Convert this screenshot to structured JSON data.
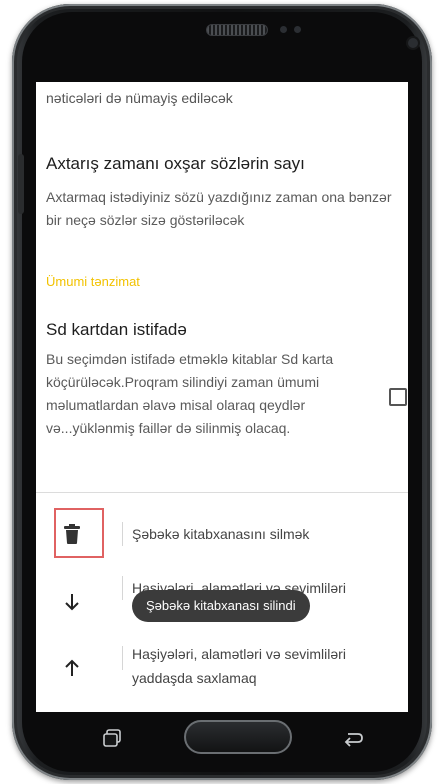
{
  "settings": {
    "prev_desc_tail": "nəticələri də nümayiş ediləcək",
    "similar_words": {
      "title": "Axtarış zamanı oxşar sözlərin sayı",
      "desc": "Axtarmaq istədiyiniz sözü yazdığınız zaman ona bənzər bir neçə sözlər sizə göstəriləcək"
    },
    "section_general": "Ümumi tənzimat",
    "sd_card": {
      "title": "Sd kartdan istifadə",
      "desc": "Bu seçimdən istifadə etməklə kitablar Sd karta köçürüləcək.Proqram silindiyi zaman ümumi məlumatlardan əlavə misal olaraq qeydlər və...yüklənmiş faillər də silinmiş olacaq.",
      "checked": false
    }
  },
  "actions": [
    {
      "icon": "trash-icon",
      "label": "Şəbəkə kitabxanasını silmək"
    },
    {
      "icon": "arrow-down-icon",
      "label": "Haşiyələri, alamətləri və sevimliləri"
    },
    {
      "icon": "arrow-up-icon",
      "label": "Haşiyələri, alamətləri və sevimliləri yaddaşda saxlamaq"
    }
  ],
  "toast": {
    "text": "Şəbəkə kitabxanası silindi"
  },
  "colors": {
    "accent_yellow": "#f2c200",
    "highlight_red": "#e06262",
    "toast_bg": "#3b3b3b"
  }
}
